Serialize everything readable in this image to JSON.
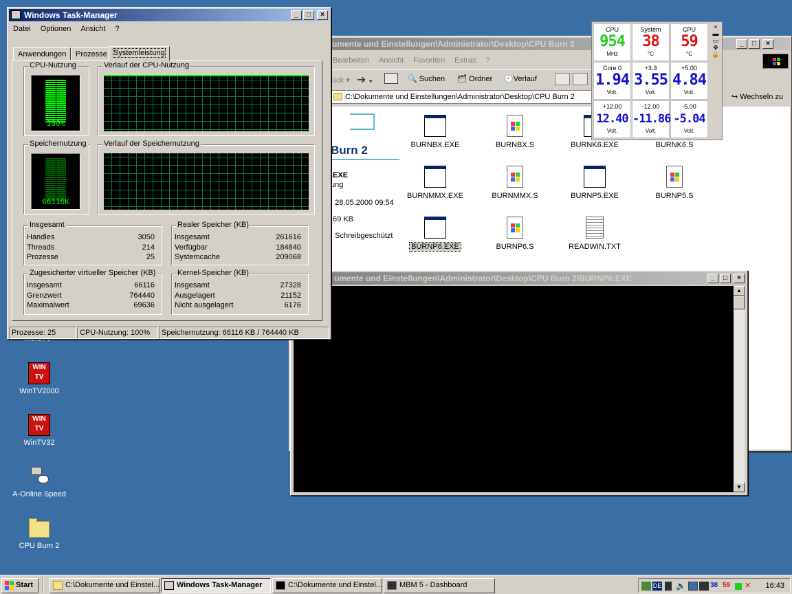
{
  "desktop": {
    "icons": [
      {
        "label": "MoreTV"
      },
      {
        "label": "WinTV2000"
      },
      {
        "label": "WinTV32"
      },
      {
        "label": "A-Online Speed"
      },
      {
        "label": "CPU Burn 2"
      }
    ]
  },
  "explorer": {
    "title": "umente und Einstellungen\\Administrator\\Desktop\\CPU Burn 2",
    "menu": [
      "Bearbeiten",
      "Ansicht",
      "Favoriten",
      "Extras",
      "?"
    ],
    "toolbar": {
      "back": "ück",
      "search": "Suchen",
      "folders": "Ordner",
      "history": "Verlauf"
    },
    "address": "C:\\Dokumente und Einstellungen\\Administrator\\Desktop\\CPU Burn 2",
    "go": "Wechseln zu",
    "sidebar": {
      "title": "Burn 2",
      "file": ".EXE",
      "kind": "ung",
      "modified": ": 28.05.2000 09:54",
      "size": ".69 KB",
      "attrs": ": Schreibgeschützt"
    },
    "files": [
      {
        "name": "BURNBX.EXE",
        "type": "exe"
      },
      {
        "name": "BURNBX.S",
        "type": "s"
      },
      {
        "name": "BURNK6.EXE",
        "type": "exe"
      },
      {
        "name": "BURNK6.S",
        "type": "s"
      },
      {
        "name": "BURNMMX.EXE",
        "type": "exe"
      },
      {
        "name": "BURNMMX.S",
        "type": "s"
      },
      {
        "name": "BURNP5.EXE",
        "type": "exe"
      },
      {
        "name": "BURNP5.S",
        "type": "s"
      },
      {
        "name": "BURNP6.EXE",
        "type": "exe"
      },
      {
        "name": "BURNP6.S",
        "type": "s"
      },
      {
        "name": "READWIN.TXT",
        "type": "txt"
      }
    ]
  },
  "console": {
    "title": "umente und Einstellungen\\Administrator\\Desktop\\CPU Burn 2\\BURNP6.EXE"
  },
  "taskmgr": {
    "title": "Windows Task-Manager",
    "menu": [
      "Datei",
      "Optionen",
      "Ansicht",
      "?"
    ],
    "tabs": [
      "Anwendungen",
      "Prozesse",
      "Systemleistung"
    ],
    "cpu_usage_label": "CPU-Nutzung",
    "cpu_history_label": "Verlauf der CPU-Nutzung",
    "mem_usage_label": "Speichernutzung",
    "mem_history_label": "Verlauf der Speichernutzung",
    "cpu_percent": 1.0,
    "cpu_value": "100%",
    "mem_value": "66116K",
    "totals": {
      "label": "Insgesamt",
      "rows": [
        [
          "Handles",
          "3050"
        ],
        [
          "Threads",
          "214"
        ],
        [
          "Prozesse",
          "25"
        ]
      ]
    },
    "physical": {
      "label": "Realer Speicher (KB)",
      "rows": [
        [
          "Insgesamt",
          "261616"
        ],
        [
          "Verfügbar",
          "184840"
        ],
        [
          "Systemcache",
          "209068"
        ]
      ]
    },
    "commit": {
      "label": "Zugesicherter virtueller Speicher (KB)",
      "rows": [
        [
          "Insgesamt",
          "66116"
        ],
        [
          "Grenzwert",
          "764440"
        ],
        [
          "Maximalwert",
          "69636"
        ]
      ]
    },
    "kernel": {
      "label": "Kernel-Speicher (KB)",
      "rows": [
        [
          "Insgesamt",
          "27328"
        ],
        [
          "Ausgelagert",
          "21152"
        ],
        [
          "Nicht ausgelagert",
          "6176"
        ]
      ]
    },
    "status": {
      "processes": "Prozesse: 25",
      "cpu": "CPU-Nutzung: 100%",
      "mem": "Speichernutzung: 66116 KB / 764440 KB"
    }
  },
  "mbm": {
    "cells": [
      {
        "title": "CPU",
        "value": "954",
        "unit": "MHz",
        "color": "#22cc22"
      },
      {
        "title": "System",
        "value": "38",
        "unit": "°C",
        "color": "#dd1111"
      },
      {
        "title": "CPU",
        "value": "59",
        "unit": "°C",
        "color": "#dd1111"
      },
      {
        "title": "Core 0",
        "value": "1.94",
        "unit": "Volt.",
        "color": "#1111cc"
      },
      {
        "title": "+3.3",
        "value": "3.55",
        "unit": "Volt.",
        "color": "#1111cc"
      },
      {
        "title": "+5.00",
        "value": "4.84",
        "unit": "Volt.",
        "color": "#1111cc"
      },
      {
        "title": "+12.00",
        "value": "12.40",
        "unit": "Volt.",
        "color": "#1111cc"
      },
      {
        "title": "-12.00",
        "value": "-11.86",
        "unit": "Volt.",
        "color": "#1111cc"
      },
      {
        "title": "-5.00",
        "value": "-5.04",
        "unit": "Volt.",
        "color": "#1111cc"
      }
    ]
  },
  "taskbar": {
    "start": "Start",
    "buttons": [
      "C:\\Dokumente und Einstel...",
      "Windows Task-Manager",
      "C:\\Dokumente und Einstel...",
      "MBM 5 - Dashboard"
    ],
    "tray": {
      "lang": "DE",
      "temp1": "38",
      "temp2": "59",
      "clock": "16:43"
    }
  }
}
